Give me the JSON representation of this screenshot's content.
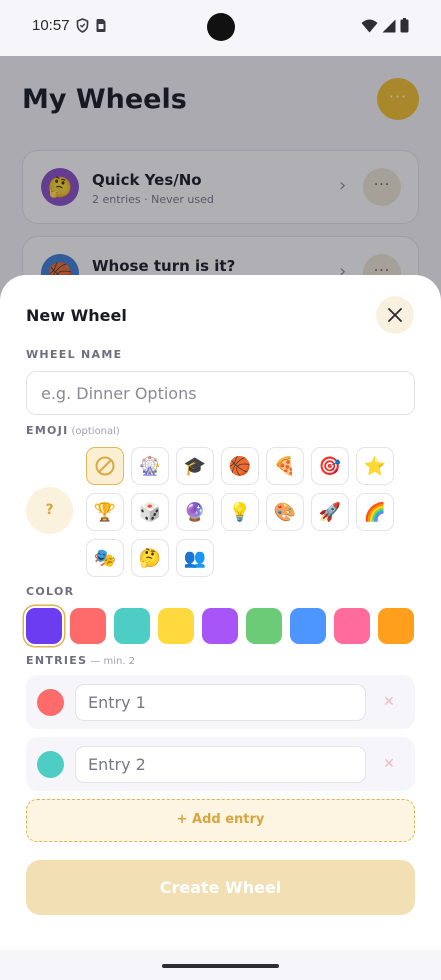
{
  "status_bar": {
    "time": "10:57",
    "left_icons": [
      "shield-icon",
      "sim-card-icon"
    ],
    "right_icons": [
      "wifi-icon",
      "cell-signal-icon",
      "battery-icon"
    ]
  },
  "background": {
    "title": "My Wheels",
    "menu_glyph": "···",
    "accent_color": "#f4c12d",
    "wheels": [
      {
        "name": "Quick Yes/No",
        "meta": "2 entries · Never used",
        "emoji": "🤔",
        "color": "#8a4fc8"
      },
      {
        "name": "Whose turn is it?",
        "meta": "",
        "emoji": "🏀",
        "color": "#3f7ed8"
      }
    ],
    "chevron_glyph": "›",
    "more_glyph": "···"
  },
  "sheet": {
    "title": "New Wheel",
    "close_glyph": "✕",
    "name_label": "WHEEL NAME",
    "name_placeholder": "e.g. Dinner Options",
    "name_value": "",
    "emoji_label": "EMOJI",
    "emoji_hint": "(optional)",
    "emoji_preview": "?",
    "emojis": [
      "∅",
      "🎡",
      "🎓",
      "🏀",
      "🍕",
      "🎯",
      "⭐",
      "🏆",
      "🎲",
      "🔮",
      "💡",
      "🎨",
      "🚀",
      "🌈",
      "🎭",
      "🤔",
      "👥"
    ],
    "selected_emoji_index": 0,
    "color_label": "COLOR",
    "colors": [
      "#6b3cf0",
      "#ff6b6b",
      "#4ecdc4",
      "#ffd93d",
      "#a855f7",
      "#6bcb77",
      "#4d96ff",
      "#ff6b9d",
      "#ff9f1c"
    ],
    "selected_color_index": 0,
    "entries_label": "ENTRIES",
    "entries_hint": "— min. 2",
    "entries": [
      {
        "placeholder": "Entry 1",
        "value": "",
        "color": "#ff6b6b"
      },
      {
        "placeholder": "Entry 2",
        "value": "",
        "color": "#4ecdc4"
      }
    ],
    "remove_glyph": "✕",
    "add_entry_label": "+ Add entry",
    "create_label": "Create Wheel"
  }
}
